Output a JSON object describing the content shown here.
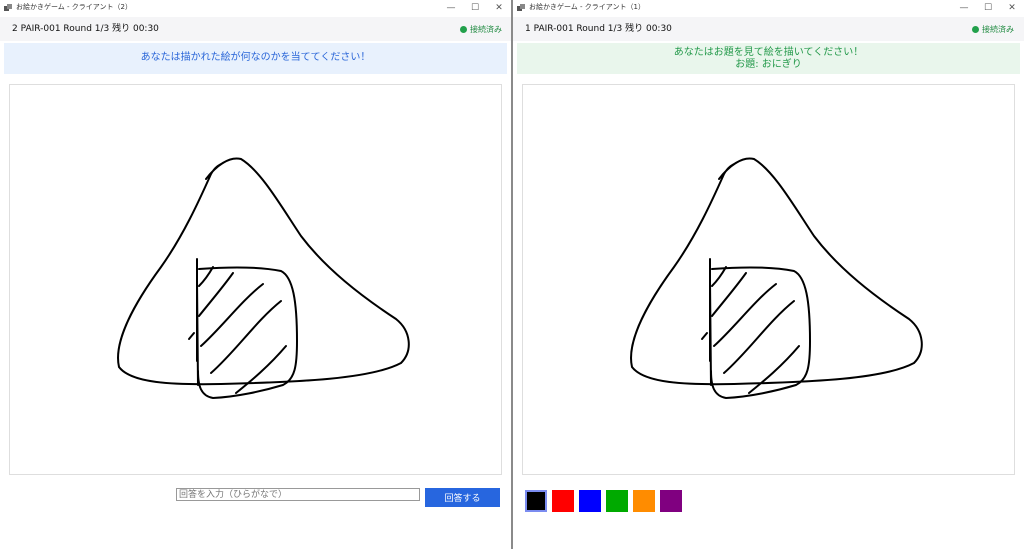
{
  "left_window": {
    "title": "お絵かきゲーム - クライアント（2）",
    "status": "2   PAIR-001   Round 1/3   残り 00:30",
    "connection": "接続済み",
    "banner": "あなたは描かれた絵が何なのかを当ててください！",
    "answer_placeholder": "回答を入力（ひらがなで）",
    "answer_value": "",
    "submit_label": "回答する"
  },
  "right_window": {
    "title": "お絵かきゲーム - クライアント（1）",
    "status": "1   PAIR-001   Round 1/3   残り 00:30",
    "connection": "接続済み",
    "banner_line1": "あなたはお題を見て絵を描いてください！",
    "banner_line2": "お題: おにぎり",
    "palette": [
      {
        "name": "black",
        "color": "#000000",
        "selected": true
      },
      {
        "name": "red",
        "color": "#ff0000",
        "selected": false
      },
      {
        "name": "blue",
        "color": "#0000ff",
        "selected": false
      },
      {
        "name": "green",
        "color": "#00aa00",
        "selected": false
      },
      {
        "name": "orange",
        "color": "#ff8c00",
        "selected": false
      },
      {
        "name": "purple",
        "color": "#800080",
        "selected": false
      }
    ]
  },
  "window_controls": {
    "minimize": "—",
    "maximize": "☐",
    "close": "✕"
  },
  "colors": {
    "accent_blue": "#2766df",
    "connected_green": "#22a04b",
    "stroke": "#000000"
  }
}
